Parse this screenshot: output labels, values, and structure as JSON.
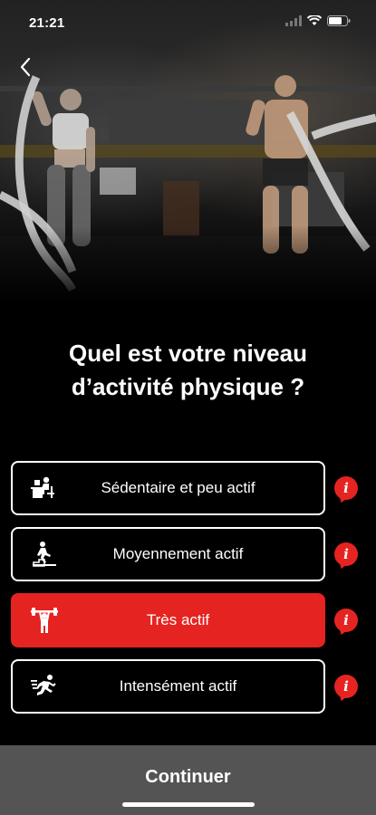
{
  "status_bar": {
    "time": "21:21"
  },
  "hero": {
    "image": "gym-battle-ropes-photo"
  },
  "title": {
    "line1": "Quel est votre niveau",
    "line2": "d’activité physique ?"
  },
  "options": [
    {
      "label": "Sédentaire et peu actif",
      "icon": "desk-sitting-icon",
      "selected": false
    },
    {
      "label": "Moyennement actif",
      "icon": "stairs-walking-icon",
      "selected": false
    },
    {
      "label": "Très actif",
      "icon": "weightlifting-icon",
      "selected": true
    },
    {
      "label": "Intensément actif",
      "icon": "running-icon",
      "selected": false
    }
  ],
  "info_icon": "i",
  "footer": {
    "continue_label": "Continuer"
  },
  "colors": {
    "accent": "#e52421",
    "footer_bg": "#545454",
    "background": "#000000"
  }
}
